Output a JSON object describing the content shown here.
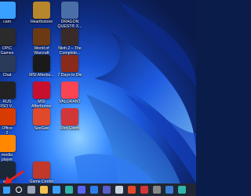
{
  "desktop": {
    "icons": [
      {
        "label": "cam",
        "icon": "cam-app-icon",
        "color": "#3aa0ff"
      },
      {
        "label": "Hearthstone",
        "icon": "hearthstone-icon",
        "color": "#b8862b"
      },
      {
        "label": "DRAGON\nQUEST® X...",
        "icon": "dragon-quest-icon",
        "color": "#4a6fa8"
      },
      {
        "label": "OPIC\nGames\nncher",
        "icon": "epic-games-launcher-icon",
        "color": "#2b2b2b"
      },
      {
        "label": "World of\nWarcraft",
        "icon": "world-of-warcraft-icon",
        "color": "#6b3a12"
      },
      {
        "label": "Nioh 2 – The\nComplete...",
        "icon": "nioh-2-icon",
        "color": "#3a2a2a"
      },
      {
        "label": "Chat",
        "icon": "chat-icon",
        "color": "#2a3a5a"
      },
      {
        "label": "MSI Afterbu...",
        "icon": "msi-afterburner-small-icon",
        "color": "#1a1a1a"
      },
      {
        "label": "7 Days to Die",
        "icon": "7-days-to-die-icon",
        "color": "#8a2a1a"
      },
      {
        "label": "RUS\nRSO V...",
        "icon": "asus-rog-icon",
        "color": "#222222"
      },
      {
        "label": "MSI\nAfterburner",
        "icon": "msi-afterburner-icon",
        "color": "#c8102e"
      },
      {
        "label": "VALORANT",
        "icon": "valorant-icon",
        "color": "#fa4454"
      },
      {
        "label": "Office\n2",
        "icon": "office-icon",
        "color": "#d83b01"
      },
      {
        "label": "SeeGee",
        "icon": "seegee-icon",
        "color": "#e04a2a"
      },
      {
        "label": "Riot Client",
        "icon": "riot-client-icon",
        "color": "#d13639"
      },
      {
        "label": "media\nplayer",
        "icon": "vlc-media-player-icon",
        "color": "#ff8800"
      },
      {
        "label": "",
        "icon": "",
        "color": ""
      },
      {
        "label": "",
        "icon": "",
        "color": ""
      },
      {
        "label": "eam",
        "icon": "steam-icon",
        "color": "#1b2838"
      },
      {
        "label": "Game Center",
        "icon": "game-center-icon",
        "color": "#c0392b"
      }
    ]
  },
  "taskbar": {
    "items": [
      {
        "name": "start-button",
        "icon": "windows-logo-icon",
        "color": "#3aa0ff"
      },
      {
        "name": "search-button",
        "icon": "search-icon",
        "color": "#ffffff"
      },
      {
        "name": "task-view-button",
        "icon": "task-view-icon",
        "color": "#9aa4b8"
      },
      {
        "name": "file-explorer-button",
        "icon": "folder-icon",
        "color": "#f2c14e"
      },
      {
        "name": "store-button",
        "icon": "store-icon",
        "color": "#3aa0ff"
      },
      {
        "name": "edge-button",
        "icon": "edge-icon",
        "color": "#2fb5a9"
      },
      {
        "name": "discord-button",
        "icon": "discord-icon",
        "color": "#5865f2"
      },
      {
        "name": "mail-button",
        "icon": "mail-icon",
        "color": "#2b7de9"
      },
      {
        "name": "teams-button",
        "icon": "teams-icon",
        "color": "#5b5fc7"
      },
      {
        "name": "steam-taskbar-button",
        "icon": "steam-icon",
        "color": "#c7d5e0"
      },
      {
        "name": "app-button-1",
        "icon": "app-icon",
        "color": "#e04a2a"
      },
      {
        "name": "app-button-2",
        "icon": "app-icon",
        "color": "#d13639"
      },
      {
        "name": "app-button-3",
        "icon": "app-icon",
        "color": "#888888"
      },
      {
        "name": "app-button-4",
        "icon": "app-icon",
        "color": "#3a7bd5"
      },
      {
        "name": "app-button-5",
        "icon": "app-icon",
        "color": "#2fb5a9"
      }
    ]
  }
}
